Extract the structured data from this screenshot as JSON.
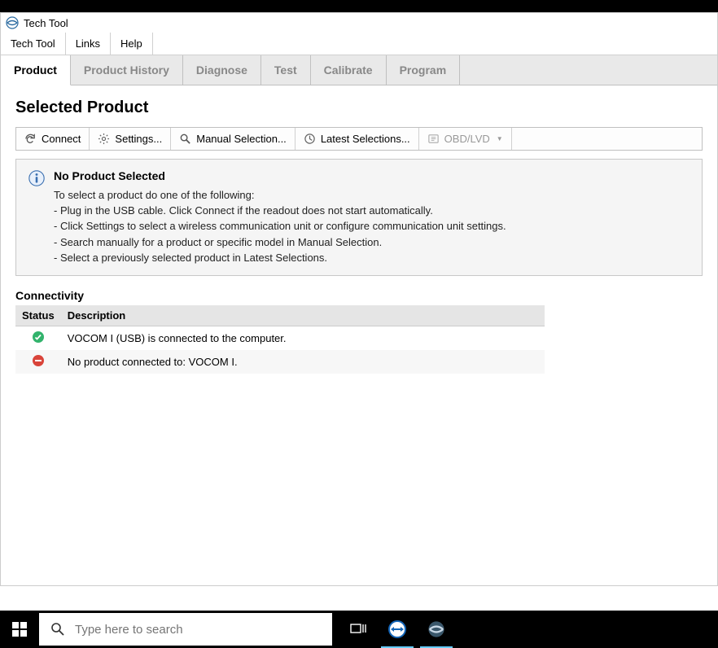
{
  "app": {
    "title": "Tech Tool"
  },
  "menubar": {
    "items": [
      "Tech Tool",
      "Links",
      "Help"
    ]
  },
  "tabs": {
    "items": [
      "Product",
      "Product History",
      "Diagnose",
      "Test",
      "Calibrate",
      "Program"
    ],
    "active": 0
  },
  "page": {
    "title": "Selected Product"
  },
  "toolbar": {
    "connect": "Connect",
    "settings": "Settings...",
    "manual": "Manual Selection...",
    "latest": "Latest Selections...",
    "obd": "OBD/LVD"
  },
  "info": {
    "title": "No Product Selected",
    "lead": "To select a product do one of the following:",
    "lines": [
      "- Plug in the USB cable. Click Connect if the readout does not start automatically.",
      "- Click Settings to select a wireless communication unit or configure communication unit settings.",
      "- Search manually for a product or specific model in Manual Selection.",
      "- Select a previously selected product in Latest Selections."
    ]
  },
  "connectivity": {
    "label": "Connectivity",
    "headers": {
      "status": "Status",
      "desc": "Description"
    },
    "rows": [
      {
        "status": "ok",
        "desc": "VOCOM I (USB) is connected to the computer."
      },
      {
        "status": "err",
        "desc": "No product connected to: VOCOM I."
      }
    ]
  },
  "taskbar": {
    "search_placeholder": "Type here to search"
  }
}
